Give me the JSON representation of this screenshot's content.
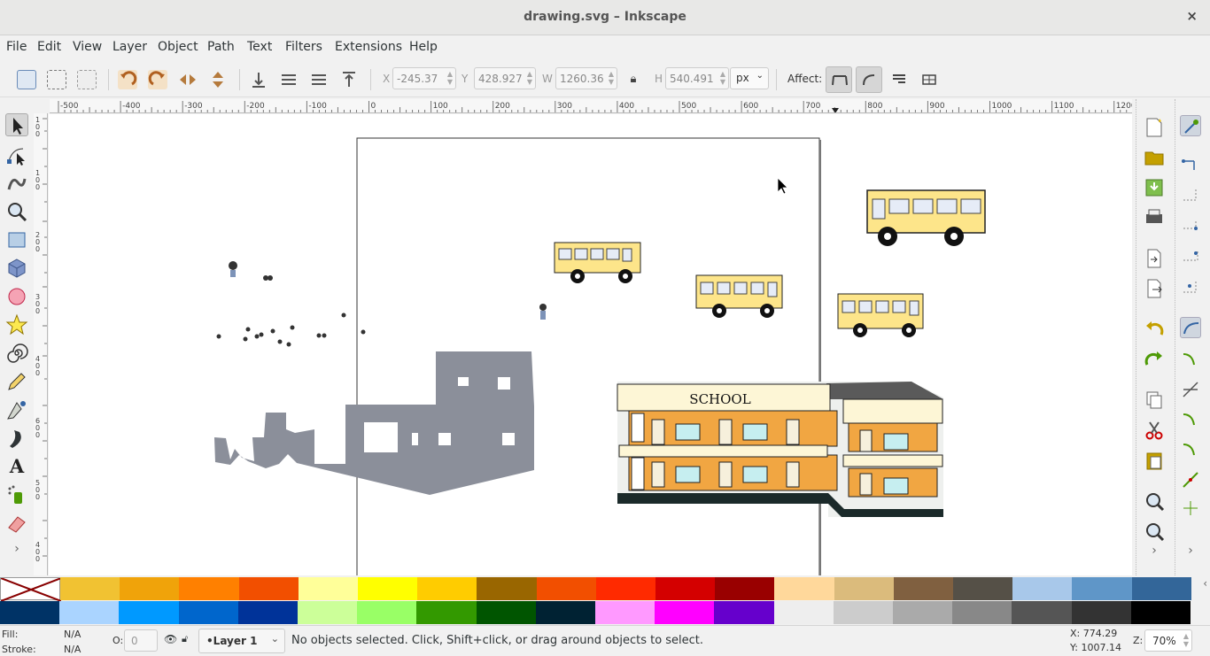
{
  "window": {
    "title": "drawing.svg – Inkscape",
    "close_glyph": "×"
  },
  "menu": [
    "File",
    "Edit",
    "View",
    "Layer",
    "Object",
    "Path",
    "Text",
    "Filters",
    "Extensions",
    "Help"
  ],
  "toolbar": {
    "x_label": "X",
    "x_value": "-245.37",
    "y_label": "Y",
    "y_value": "428.927",
    "w_label": "W",
    "w_value": "1260.36",
    "h_label": "H",
    "h_value": "540.491",
    "unit": "px",
    "affect_label": "Affect:"
  },
  "ruler": {
    "h_ticks": [
      "-500",
      "-400",
      "-300",
      "-200",
      "-100",
      "0",
      "100",
      "200",
      "300",
      "400",
      "500",
      "600",
      "700",
      "800",
      "900",
      "1000",
      "1100",
      "1200"
    ],
    "v_ticks": [
      "1\n0\n0",
      "1\n0\n0",
      "2\n0\n0",
      "3\n0\n0",
      "4\n0\n0",
      "5\n0\n0",
      "6\n0\n0",
      "7\n0\n0",
      "8\n0\n0"
    ]
  },
  "canvas": {
    "school_sign": "SCHOOL"
  },
  "palette": {
    "row1": [
      "#f1c232",
      "#f0a30a",
      "#ff8000",
      "#f24f00",
      "#ffff99",
      "#ffff00",
      "#ffcc00",
      "#996600",
      "#f24f00",
      "#ff2a00",
      "#d40000",
      "#990000",
      "#ffd89b",
      "#dbbb7c",
      "#806040",
      "#555047",
      "#a8c8ea",
      "#5f96c8",
      "#336699"
    ],
    "row2": [
      "#003366",
      "#aad4ff",
      "#0099ff",
      "#0066cc",
      "#003399",
      "#ccff99",
      "#99ff66",
      "#339900",
      "#005500",
      "#002233",
      "#ff99ff",
      "#ff00ff",
      "#6600cc",
      "#eeeeee",
      "#cccccc",
      "#aaaaaa",
      "#888888",
      "#555555",
      "#333333",
      "#000000"
    ]
  },
  "status": {
    "fill_label": "Fill:",
    "fill_value": "N/A",
    "stroke_label": "Stroke:",
    "stroke_value": "N/A",
    "opacity_label": "O:",
    "opacity_value": "0",
    "layer": "•Layer 1",
    "message": "No objects selected. Click, Shift+click, or drag around objects to select.",
    "x_coord": "X:   774.29",
    "y_coord": "Y: 1007.14",
    "zoom_label": "Z:",
    "zoom_value": "70%"
  }
}
